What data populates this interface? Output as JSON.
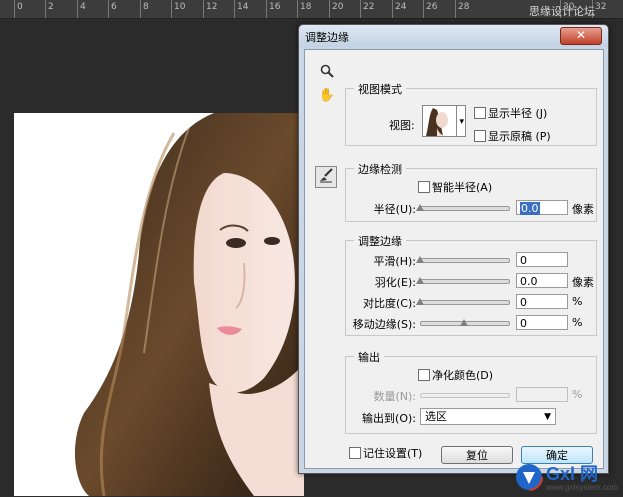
{
  "workspace": {
    "ruler_labels": [
      "0",
      "2",
      "4",
      "6",
      "8",
      "10",
      "12",
      "14",
      "16",
      "18",
      "20",
      "22",
      "24",
      "26",
      "28",
      "30",
      "32"
    ],
    "watermark": "思缘设计论坛"
  },
  "dialog": {
    "title": "调整边缘",
    "close_glyph": "✕",
    "view_mode": {
      "legend": "视图模式",
      "view_label": "视图:",
      "show_radius": "显示半径 (J)",
      "show_original": "显示原稿 (P)"
    },
    "edge_detection": {
      "legend": "边缘检测",
      "smart_radius": "智能半径(A)",
      "radius_label": "半径(U):",
      "radius_value": "0.0",
      "radius_unit": "像素"
    },
    "adjust_edge": {
      "legend": "调整边缘",
      "smooth_label": "平滑(H):",
      "smooth_value": "0",
      "feather_label": "羽化(E):",
      "feather_value": "0.0",
      "feather_unit": "像素",
      "contrast_label": "对比度(C):",
      "contrast_value": "0",
      "contrast_unit": "%",
      "shift_label": "移动边缘(S):",
      "shift_value": "0",
      "shift_unit": "%"
    },
    "output": {
      "legend": "输出",
      "decontaminate": "净化颜色(D)",
      "amount_label": "数量(N):",
      "amount_unit": "%",
      "output_to_label": "输出到(O):",
      "output_to_value": "选区"
    },
    "remember": "记住设置(T)",
    "reset_button": "复位",
    "ok_button": "确定"
  },
  "logo": {
    "text": "Gxl 网",
    "url": "www.gxlsystem.com"
  },
  "colors": {
    "accent_selection": "#3a6fc4",
    "logo_blue": "#1f66c8",
    "logo_red": "#d23c2a"
  }
}
